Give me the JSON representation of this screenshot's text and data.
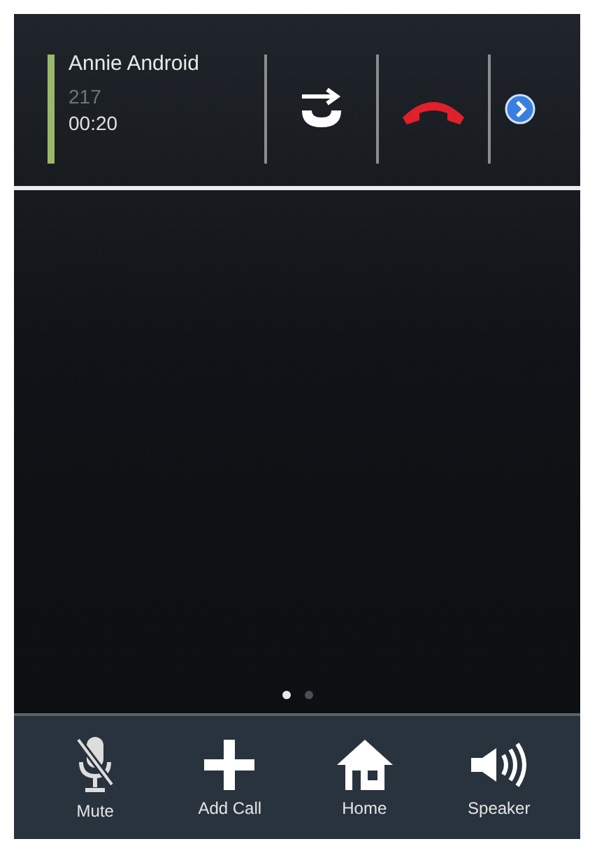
{
  "call": {
    "name": "Annie Android",
    "number": "217",
    "duration": "00:20",
    "color": "#9bb86a"
  },
  "call_actions": [
    {
      "kind": "swap"
    },
    {
      "kind": "hangup"
    },
    {
      "kind": "more"
    }
  ],
  "page_dots": [
    {
      "selected": true
    },
    {
      "selected": false
    }
  ],
  "toolbar": [
    {
      "kind": "mute",
      "label": "Mute"
    },
    {
      "kind": "add",
      "label": "Add Call"
    },
    {
      "kind": "home",
      "label": "Home"
    },
    {
      "kind": "speaker",
      "label": "Speaker"
    }
  ]
}
